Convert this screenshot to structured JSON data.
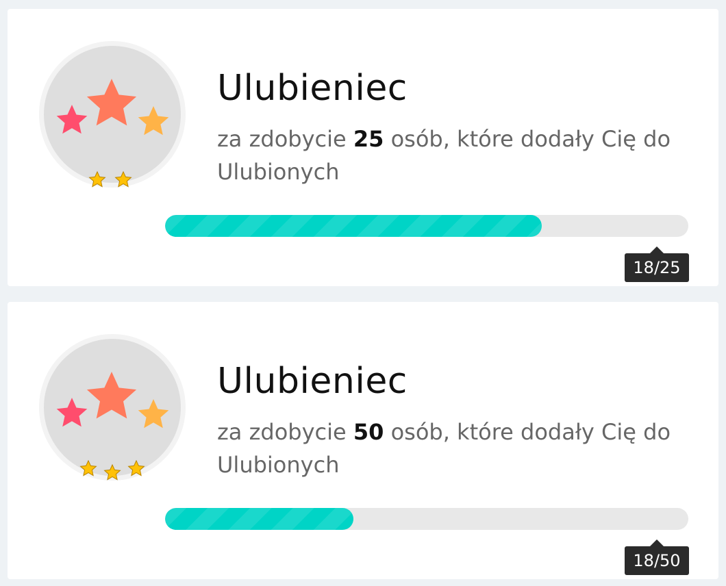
{
  "achievements": [
    {
      "title": "Ulubieniec",
      "desc_prefix": "za zdobycie ",
      "desc_number": "25",
      "desc_suffix": " osób, które dodały Cię do Ulubionych",
      "progress_label": "18/25",
      "progress_value": 18,
      "progress_max": 25,
      "level_stars": 2,
      "colors": {
        "progress_fill": "#00d4c6",
        "star_pink": "#ff4d6d",
        "star_coral": "#ff7a5c",
        "star_orange": "#ffb347",
        "level_star": "#ffc107"
      }
    },
    {
      "title": "Ulubieniec",
      "desc_prefix": "za zdobycie ",
      "desc_number": "50",
      "desc_suffix": " osób, które dodały Cię do Ulubionych",
      "progress_label": "18/50",
      "progress_value": 18,
      "progress_max": 50,
      "level_stars": 3,
      "colors": {
        "progress_fill": "#00d4c6",
        "star_pink": "#ff4d6d",
        "star_coral": "#ff7a5c",
        "star_orange": "#ffb347",
        "level_star": "#ffc107"
      }
    }
  ]
}
